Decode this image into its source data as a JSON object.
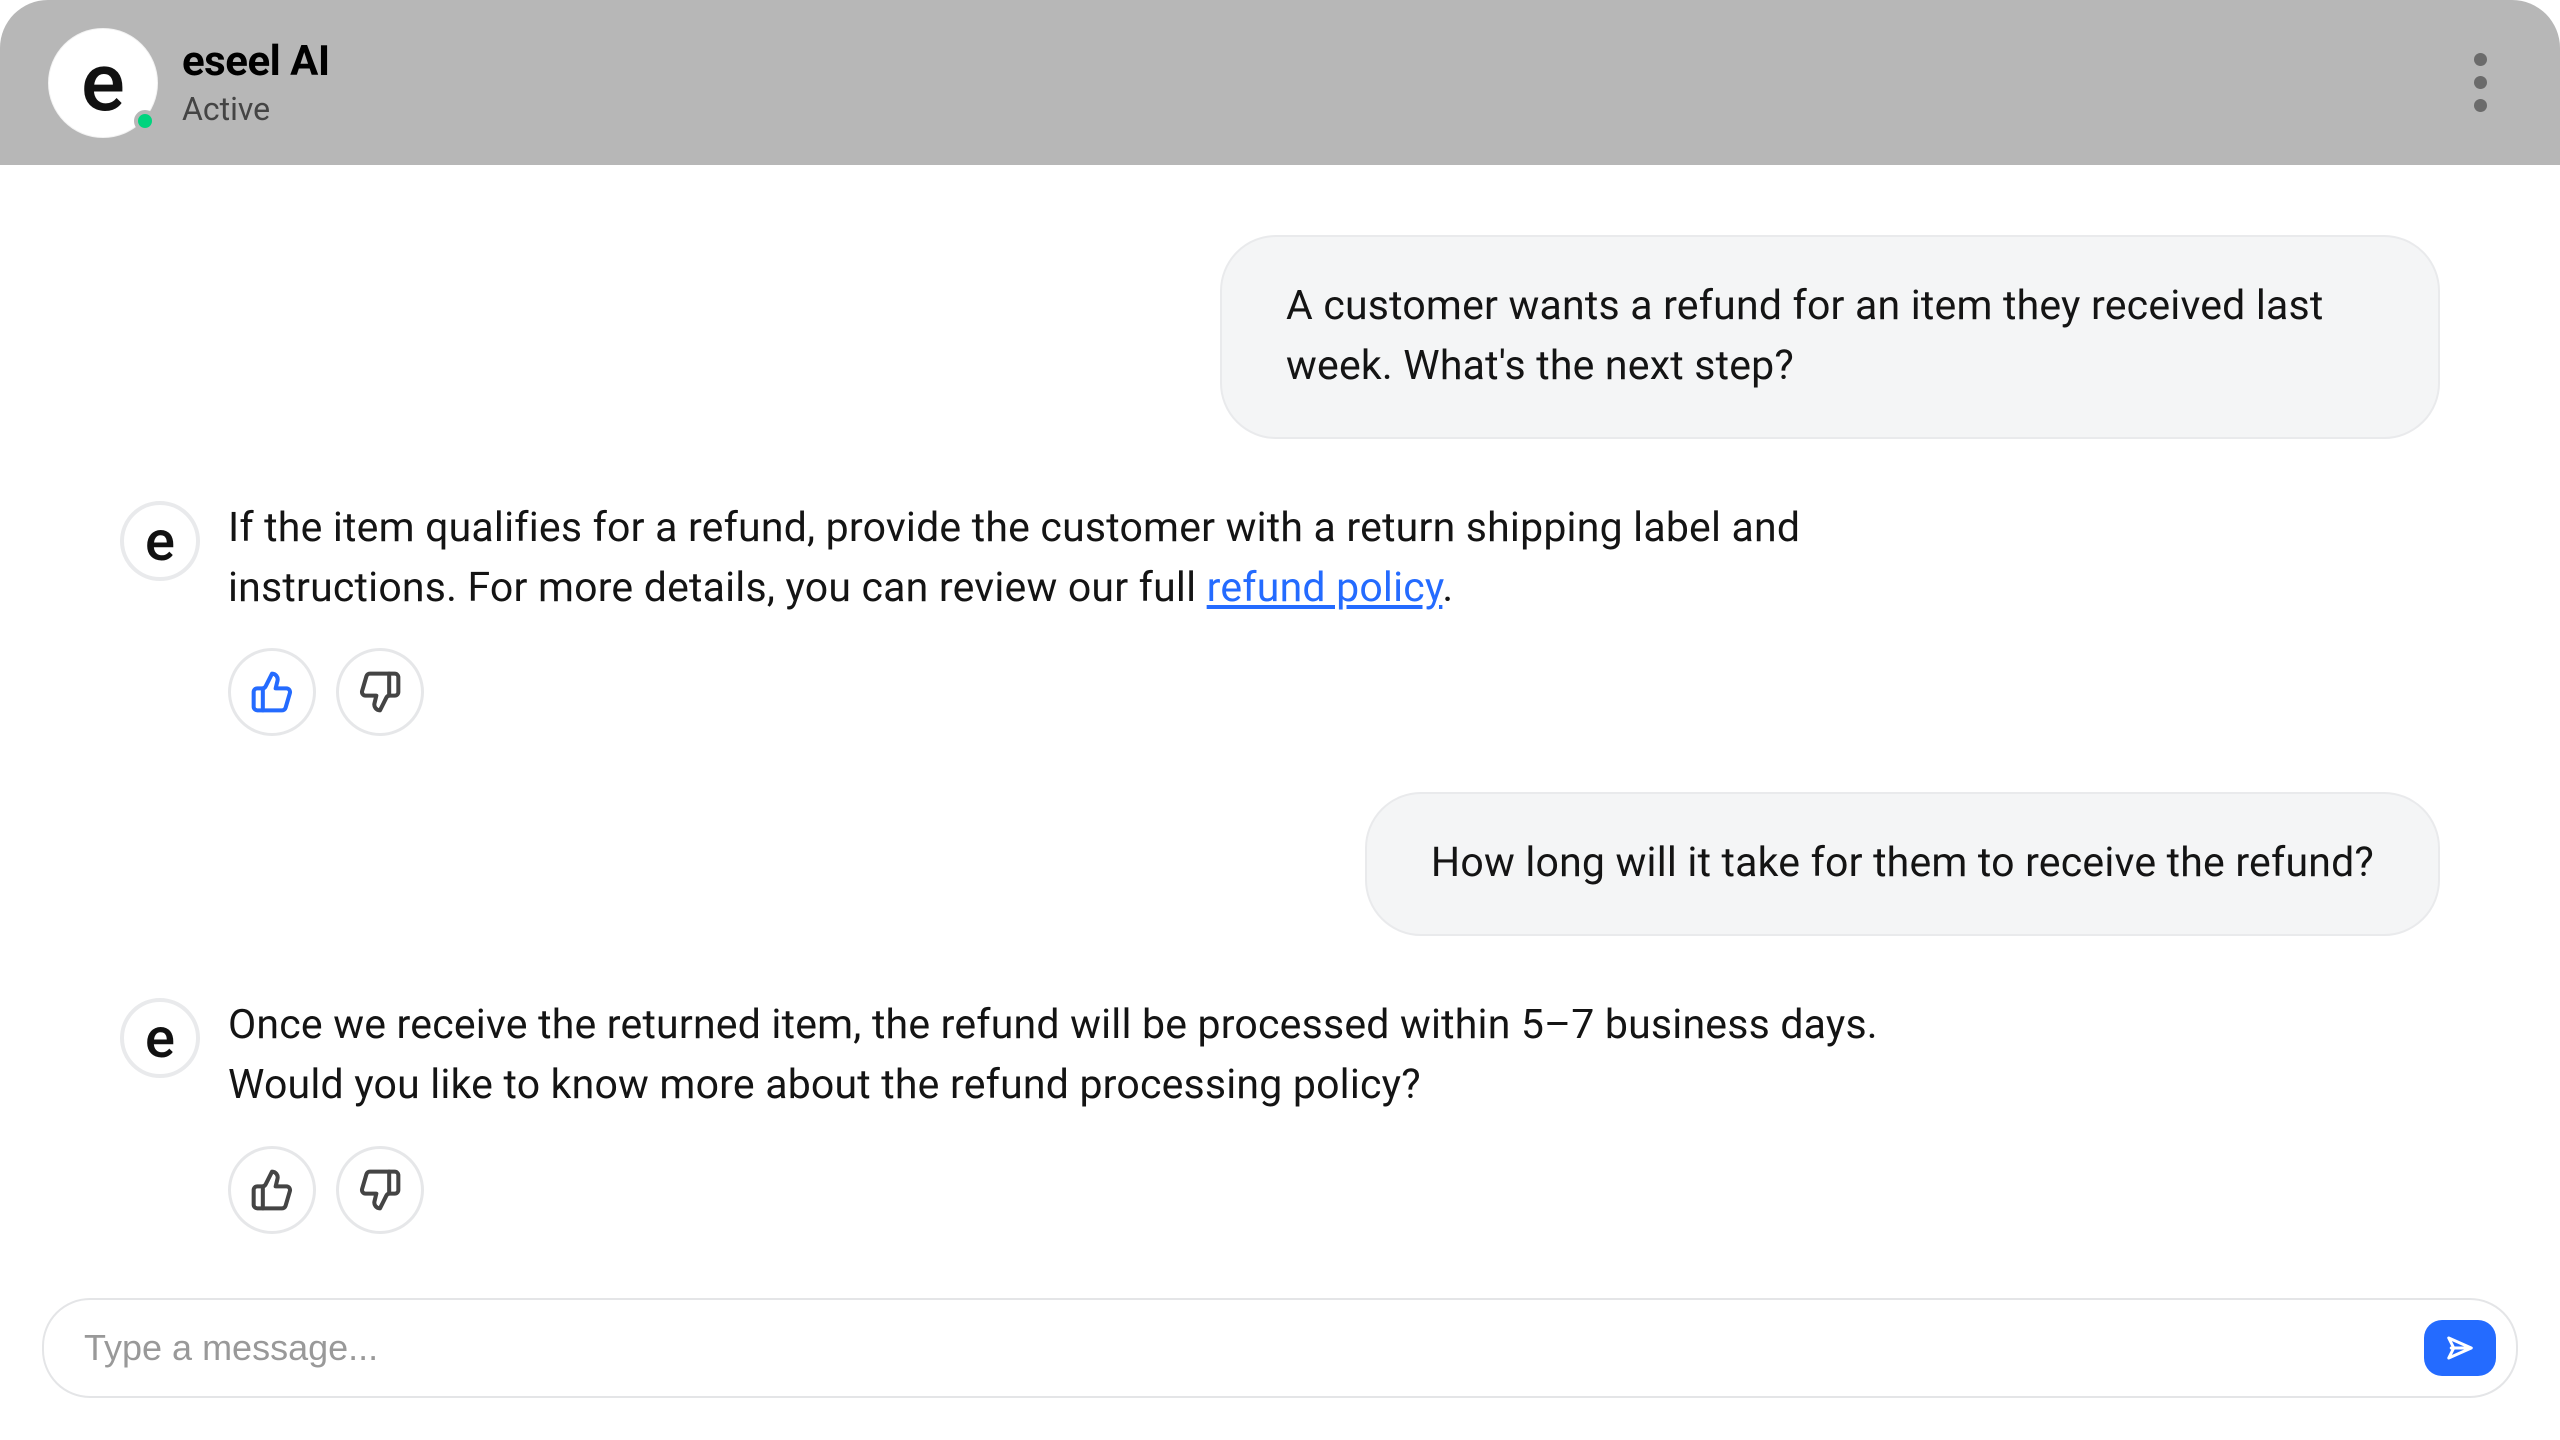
{
  "header": {
    "avatar_glyph": "e",
    "title": "eseel AI",
    "status": "Active"
  },
  "thread": {
    "messages": [
      {
        "role": "user",
        "text": "A customer wants a refund for an item they received last week. What's the next step?"
      },
      {
        "role": "bot",
        "text_pre_link": "If the item qualifies for a refund, provide the customer with a return shipping label and instructions. For more details, you can review our full ",
        "link_text": "refund policy",
        "text_post_link": ".",
        "liked": true
      },
      {
        "role": "user",
        "text": "How long will it take for them to receive the refund?"
      },
      {
        "role": "bot",
        "text": "Once we receive the returned item, the refund will be processed within 5–7 business days. Would you like to know more about the refund processing policy?",
        "liked": false
      }
    ]
  },
  "bot_avatar_glyph": "e",
  "composer": {
    "placeholder": "Type a message...",
    "value": ""
  },
  "colors": {
    "accent": "#246bff",
    "presence": "#00d47e",
    "header_bg": "#b7b7b7"
  }
}
